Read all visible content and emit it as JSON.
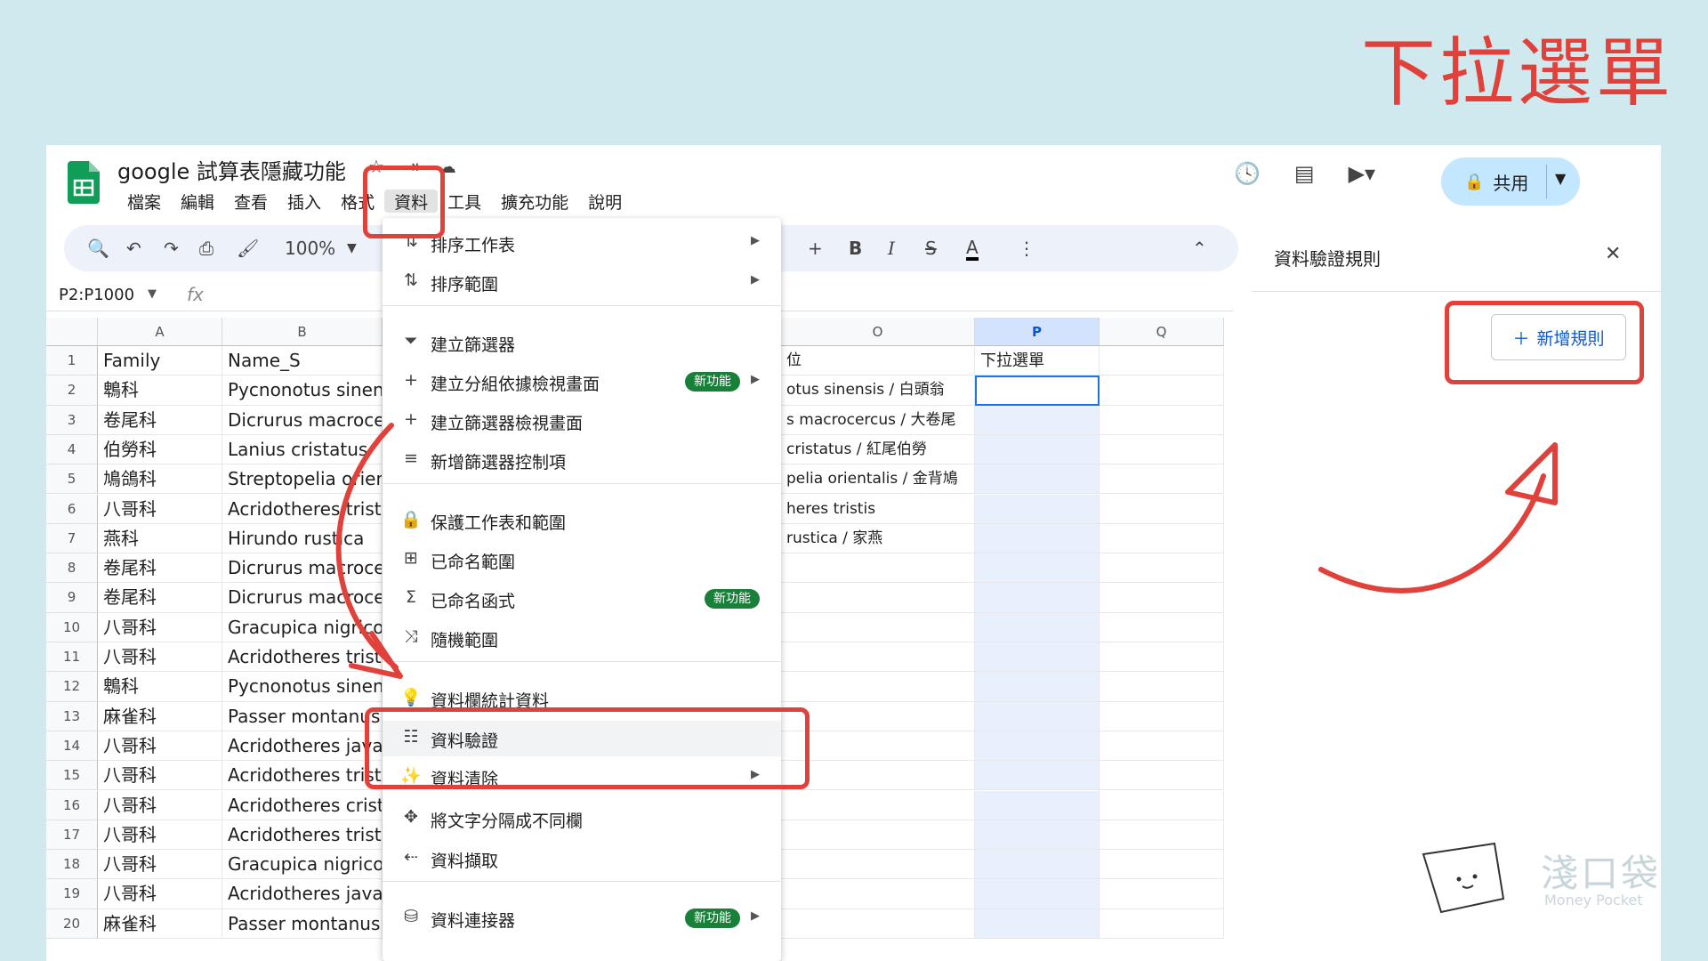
{
  "heading": "下拉選單",
  "app": {
    "title": "google 試算表隱藏功能",
    "menu": [
      "檔案",
      "編輯",
      "查看",
      "插入",
      "格式",
      "資料",
      "工具",
      "擴充功能",
      "說明"
    ],
    "share_label": "共用",
    "icons": {
      "logo": "sheets-logo-icon",
      "history": "history-icon",
      "comment": "comment-icon",
      "meet": "video-icon"
    }
  },
  "toolbar": {
    "zoom": "100%"
  },
  "namebox": "P2:P1000",
  "fx_label": "fx",
  "grid": {
    "columns": [
      "A",
      "B",
      "O",
      "P",
      "Q"
    ],
    "rows": [
      "1",
      "2",
      "3",
      "4",
      "5",
      "6",
      "7",
      "8",
      "9",
      "10",
      "11",
      "12",
      "13",
      "14",
      "15",
      "16",
      "17",
      "18",
      "19",
      "20"
    ],
    "colA": [
      "Family",
      "鵯科",
      "卷尾科",
      "伯勞科",
      "鳩鴿科",
      "八哥科",
      "燕科",
      "卷尾科",
      "卷尾科",
      "八哥科",
      "八哥科",
      "鵯科",
      "麻雀科",
      "八哥科",
      "八哥科",
      "八哥科",
      "八哥科",
      "八哥科",
      "八哥科",
      "麻雀科"
    ],
    "colB": [
      "Name_S",
      "Pycnonotus sinen",
      "Dicrurus macroce",
      "Lanius cristatus",
      "Streptopelia orien",
      "Acridotheres tristi",
      "Hirundo rustica",
      "Dicrurus macroce",
      "Dicrurus macroce",
      "Gracupica nigrico",
      "Acridotheres tristi",
      "Pycnonotus sinen",
      "Passer montanus",
      "Acridotheres java",
      "Acridotheres tristi",
      "Acridotheres crist",
      "Acridotheres tristi",
      "Gracupica nigrico",
      "Acridotheres java",
      "Passer montanus"
    ],
    "colO": [
      "位",
      "otus sinensis / 白頭翁",
      "s macrocercus / 大卷尾",
      "cristatus / 紅尾伯勞",
      "pelia orientalis / 金背鳩",
      "heres tristis",
      "rustica / 家燕"
    ],
    "colP_header": "下拉選單"
  },
  "dropdown": {
    "items": [
      {
        "label": "排序工作表",
        "icon": "sort-icon",
        "submenu": true
      },
      {
        "label": "排序範圍",
        "icon": "sort-range-icon",
        "submenu": true
      },
      {
        "label": "建立篩選器",
        "icon": "filter-icon"
      },
      {
        "label": "建立分組依據檢視畫面",
        "icon": "plus-icon",
        "badge": "新功能",
        "submenu": true
      },
      {
        "label": "建立篩選器檢視畫面",
        "icon": "plus-icon"
      },
      {
        "label": "新增篩選器控制項",
        "icon": "filter-lines-icon"
      },
      {
        "label": "保護工作表和範圍",
        "icon": "lock-icon"
      },
      {
        "label": "已命名範圍",
        "icon": "named-range-icon"
      },
      {
        "label": "已命名函式",
        "icon": "sigma-icon",
        "badge": "新功能"
      },
      {
        "label": "隨機範圍",
        "icon": "shuffle-icon"
      },
      {
        "label": "資料欄統計資料",
        "icon": "lightbulb-icon"
      },
      {
        "label": "資料驗證",
        "icon": "data-validation-icon"
      },
      {
        "label": "資料清除",
        "icon": "magic-wand-icon",
        "submenu": true
      },
      {
        "label": "將文字分隔成不同欄",
        "icon": "split-icon"
      },
      {
        "label": "資料擷取",
        "icon": "extract-icon"
      },
      {
        "label": "資料連接器",
        "icon": "database-icon",
        "badge": "新功能",
        "submenu": true
      }
    ]
  },
  "panel": {
    "title": "資料驗證規則",
    "add_rule": "新增規則"
  },
  "watermark": {
    "title": "淺口袋",
    "subtitle": "Money Pocket"
  },
  "colors": {
    "accent_red": "#e0413a",
    "sheets_green": "#188038",
    "share_blue": "#c2e7ff"
  }
}
